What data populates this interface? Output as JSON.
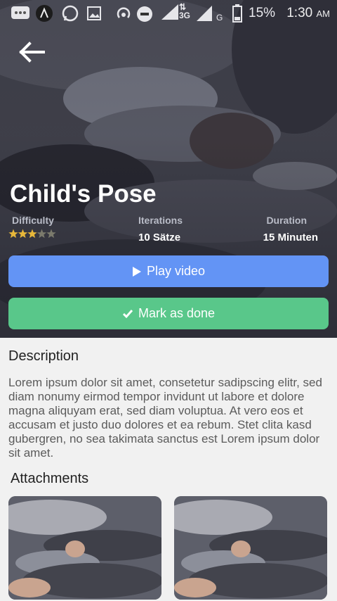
{
  "status_bar": {
    "battery": "15%",
    "time": "1:30",
    "ampm": "AM",
    "network": "3G",
    "carrier": "G",
    "icons": [
      "chat-icon",
      "app-icon",
      "whatsapp-icon",
      "image-icon",
      "hotspot-icon",
      "dnd-icon",
      "signal-icon",
      "battery-icon"
    ]
  },
  "exercise": {
    "title": "Child's Pose",
    "difficulty_label": "Difficulty",
    "difficulty_rating": 3,
    "difficulty_max": 5,
    "iterations_label": "Iterations",
    "iterations_value": "10 Sätze",
    "duration_label": "Duration",
    "duration_value": "15 Minuten"
  },
  "actions": {
    "play_label": "Play video",
    "done_label": "Mark as done"
  },
  "colors": {
    "play": "#6394f5",
    "done": "#59c78a",
    "star_on": "#e7b73a",
    "star_off": "#7b7a6c"
  },
  "description": {
    "heading": "Description",
    "text": "Lorem ipsum dolor sit amet, consetetur sadipscing elitr, sed diam nonumy eirmod tempor invidunt ut labore et dolore magna aliquyam erat, sed diam voluptua. At vero eos et accusam et justo duo dolores et ea rebum. Stet clita kasd gubergren, no sea takimata sanctus est Lorem ipsum dolor sit amet."
  },
  "attachments": {
    "heading": "Attachments",
    "count": 2
  }
}
